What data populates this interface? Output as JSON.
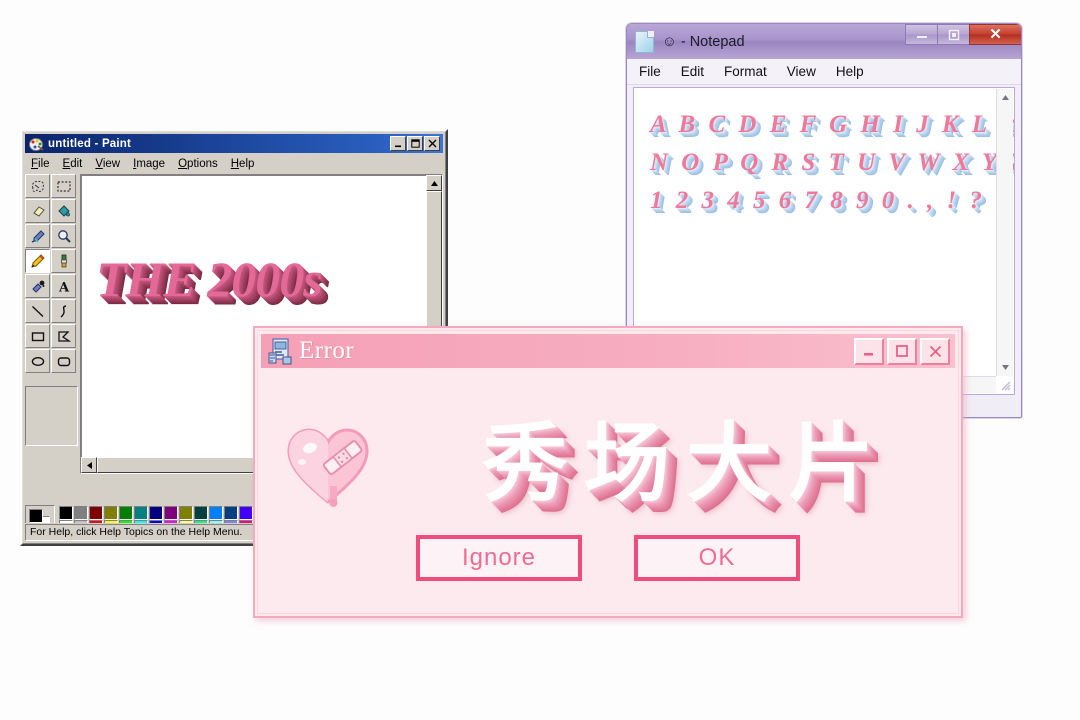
{
  "paint": {
    "title": "untitled - Paint",
    "icon": "paint-palette-icon",
    "window_buttons": [
      {
        "name": "minimize",
        "glyph": "_"
      },
      {
        "name": "maximize",
        "glyph": "❐"
      },
      {
        "name": "close",
        "glyph": "✕"
      }
    ],
    "menus": [
      {
        "label": "File",
        "mnemonic": "F"
      },
      {
        "label": "Edit",
        "mnemonic": "E"
      },
      {
        "label": "View",
        "mnemonic": "V"
      },
      {
        "label": "Image",
        "mnemonic": "I"
      },
      {
        "label": "Options",
        "mnemonic": "O"
      },
      {
        "label": "Help",
        "mnemonic": "H"
      }
    ],
    "tools": [
      "free-form-select-icon",
      "rectangle-select-icon",
      "eraser-icon",
      "fill-bucket-icon",
      "color-picker-icon",
      "magnifier-icon",
      "pencil-icon",
      "brush-icon",
      "airbrush-icon",
      "text-tool-icon",
      "line-icon",
      "curve-icon",
      "rectangle-icon",
      "polygon-icon",
      "ellipse-icon",
      "rounded-rectangle-icon"
    ],
    "active_tool": "pencil-icon",
    "canvas_text": "THE 2000s",
    "canvas_text_color": "#e36a96",
    "palette_top": [
      "#000000",
      "#808080",
      "#7f0000",
      "#808000",
      "#008000",
      "#008080",
      "#000080",
      "#7f007f",
      "#7f7f00",
      "#004040",
      "#0080ff",
      "#004080",
      "#4000ff",
      "#804000"
    ],
    "palette_bottom": [
      "#ffffff",
      "#c0c0c0",
      "#ff0000",
      "#ffff00",
      "#00ff00",
      "#00ffff",
      "#0000ff",
      "#ff00ff",
      "#ffff80",
      "#00ff80",
      "#80ffff",
      "#8080ff",
      "#ff0080",
      "#ff8040"
    ],
    "foreground_color": "#000000",
    "background_color": "#ffffff",
    "statusbar": "For Help, click Help Topics on the Help Menu."
  },
  "notepad": {
    "title": "☺ - Notepad",
    "icon": "notepad-document-icon",
    "window_buttons": [
      {
        "name": "minimize",
        "glyph": "–"
      },
      {
        "name": "restore",
        "glyph": "▣"
      },
      {
        "name": "close",
        "glyph": "✕"
      }
    ],
    "menus": [
      "File",
      "Edit",
      "Format",
      "View",
      "Help"
    ],
    "lines": [
      "A B C D E F G H I J K L M",
      "N O P Q R S T U V W X Y Z",
      "1 2 3 4 5 6 7 8 9 0 . , ! ?"
    ],
    "text_color": "#f07898",
    "shadow_color": "#9cc2e6"
  },
  "error_dialog": {
    "title": "Error",
    "icon": "installer-error-icon",
    "window_buttons": [
      {
        "name": "minimize",
        "glyph": "_"
      },
      {
        "name": "maximize",
        "glyph": "□"
      },
      {
        "name": "close",
        "glyph": "✕"
      }
    ],
    "heart_icon": "broken-heart-bandaid-icon",
    "headline": "秀场大片",
    "buttons": [
      {
        "name": "ignore",
        "label": "Ignore"
      },
      {
        "name": "ok",
        "label": "OK"
      }
    ],
    "accent_color": "#ef4d7f",
    "titlebar_color": "#f5a0b6",
    "body_color": "#fdeaee"
  }
}
